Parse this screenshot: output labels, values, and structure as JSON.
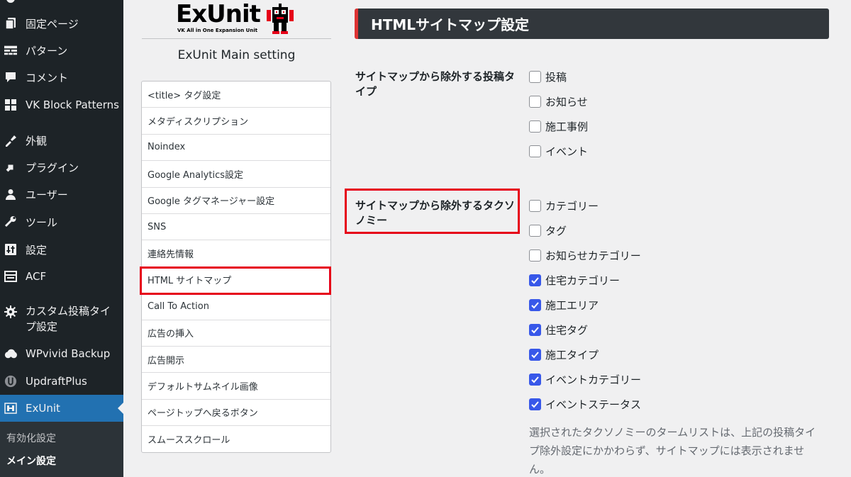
{
  "sidebar": {
    "items": [
      {
        "label": "固定ページ",
        "icon": "page-icon"
      },
      {
        "label": "パターン",
        "icon": "patterns-icon"
      },
      {
        "label": "コメント",
        "icon": "comment-icon"
      },
      {
        "label": "VK Block Patterns",
        "icon": "grid-icon"
      },
      {
        "label": "外観",
        "icon": "appearance-icon"
      },
      {
        "label": "プラグイン",
        "icon": "plugin-icon"
      },
      {
        "label": "ユーザー",
        "icon": "user-icon"
      },
      {
        "label": "ツール",
        "icon": "tools-icon"
      },
      {
        "label": "設定",
        "icon": "settings-icon"
      },
      {
        "label": "ACF",
        "icon": "acf-icon"
      },
      {
        "label": "カスタム投稿タイプ設定",
        "icon": "gear-icon"
      },
      {
        "label": "WPvivid Backup",
        "icon": "cloud-icon"
      },
      {
        "label": "UpdraftPlus",
        "icon": "updraft-icon"
      },
      {
        "label": "ExUnit",
        "icon": "exunit-icon"
      }
    ],
    "submenu": [
      {
        "label": "有効化設定"
      },
      {
        "label": "メイン設定"
      }
    ]
  },
  "exunit": {
    "logo_text": "ExUnit",
    "logo_sub": "VK All in One Expansion Unit",
    "panel_title": "ExUnit Main setting",
    "nav": [
      "<title> タグ設定",
      "メタディスクリプション",
      "Noindex",
      "Google Analytics設定",
      "Google タグマネージャー設定",
      "SNS",
      "連絡先情報",
      "HTML サイトマップ",
      "Call To Action",
      "広告の挿入",
      "広告開示",
      "デフォルトサムネイル画像",
      "ページトップへ戻るボタン",
      "スムーススクロール"
    ]
  },
  "content": {
    "section_title": "HTMLサイトマップ設定",
    "post_types_label": "サイトマップから除外する投稿タイプ",
    "post_types": [
      {
        "label": "投稿",
        "checked": false
      },
      {
        "label": "お知らせ",
        "checked": false
      },
      {
        "label": "施工事例",
        "checked": false
      },
      {
        "label": "イベント",
        "checked": false
      }
    ],
    "taxonomies_label": "サイトマップから除外するタクソノミー",
    "taxonomies": [
      {
        "label": "カテゴリー",
        "checked": false
      },
      {
        "label": "タグ",
        "checked": false
      },
      {
        "label": "お知らせカテゴリー",
        "checked": false
      },
      {
        "label": "住宅カテゴリー",
        "checked": true
      },
      {
        "label": "施工エリア",
        "checked": true
      },
      {
        "label": "住宅タグ",
        "checked": true
      },
      {
        "label": "施工タイプ",
        "checked": true
      },
      {
        "label": "イベントカテゴリー",
        "checked": true
      },
      {
        "label": "イベントステータス",
        "checked": true
      }
    ],
    "description": "選択されたタクソノミーのタームリストは、上記の投稿タイプ除外設定にかかわらず、サイトマップには表示されません。"
  },
  "colors": {
    "admin_bg": "#1d2327",
    "admin_current": "#2271b1",
    "header_bg": "#32373c",
    "header_accent": "#dd3333",
    "highlight": "#e60019",
    "checkbox_checked": "#3858e9"
  }
}
